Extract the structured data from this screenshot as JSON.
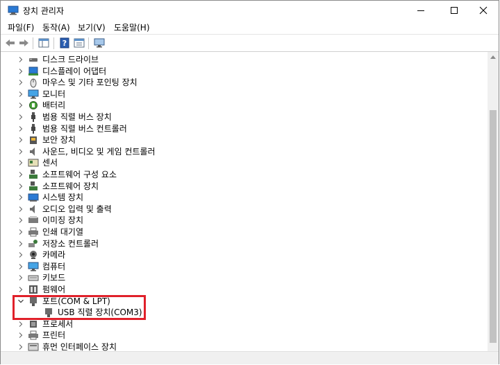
{
  "window": {
    "title": "장치 관리자",
    "controls": [
      "minimize-icon",
      "maximize-icon",
      "close-icon"
    ]
  },
  "menubar": [
    {
      "label": "파일(F)"
    },
    {
      "label": "동작(A)"
    },
    {
      "label": "보기(V)"
    },
    {
      "label": "도움말(H)"
    }
  ],
  "toolbar": {
    "buttons": [
      "back-icon",
      "forward-icon",
      "properties-icon",
      "help-icon",
      "scan-icon",
      "monitor-icon"
    ]
  },
  "tree": {
    "items": [
      {
        "label": "디스크 드라이브",
        "icon": "disk-icon",
        "expanded": false,
        "indent": 0
      },
      {
        "label": "디스플레이 어댑터",
        "icon": "display-adapter-icon",
        "expanded": false,
        "indent": 0
      },
      {
        "label": "마우스 및 기타 포인팅 장치",
        "icon": "mouse-icon",
        "expanded": false,
        "indent": 0
      },
      {
        "label": "모니터",
        "icon": "monitor-icon",
        "expanded": false,
        "indent": 0
      },
      {
        "label": "배터리",
        "icon": "battery-icon",
        "expanded": false,
        "indent": 0
      },
      {
        "label": "범용 직렬 버스 장치",
        "icon": "usb-icon",
        "expanded": false,
        "indent": 0
      },
      {
        "label": "범용 직렬 버스 컨트롤러",
        "icon": "usb-icon",
        "expanded": false,
        "indent": 0
      },
      {
        "label": "보안 장치",
        "icon": "security-icon",
        "expanded": false,
        "indent": 0
      },
      {
        "label": "사운드, 비디오 및 게임 컨트롤러",
        "icon": "speaker-icon",
        "expanded": false,
        "indent": 0
      },
      {
        "label": "센서",
        "icon": "sensor-icon",
        "expanded": false,
        "indent": 0
      },
      {
        "label": "소프트웨어 구성 요소",
        "icon": "software-icon",
        "expanded": false,
        "indent": 0
      },
      {
        "label": "소프트웨어 장치",
        "icon": "software-icon",
        "expanded": false,
        "indent": 0
      },
      {
        "label": "시스템 장치",
        "icon": "system-icon",
        "expanded": false,
        "indent": 0
      },
      {
        "label": "오디오 입력 및 출력",
        "icon": "speaker-icon",
        "expanded": false,
        "indent": 0
      },
      {
        "label": "이미징 장치",
        "icon": "imaging-icon",
        "expanded": false,
        "indent": 0
      },
      {
        "label": "인쇄 대기열",
        "icon": "printer-icon",
        "expanded": false,
        "indent": 0
      },
      {
        "label": "저장소 컨트롤러",
        "icon": "storage-icon",
        "expanded": false,
        "indent": 0
      },
      {
        "label": "카메라",
        "icon": "camera-icon",
        "expanded": false,
        "indent": 0
      },
      {
        "label": "컴퓨터",
        "icon": "computer-icon",
        "expanded": false,
        "indent": 0
      },
      {
        "label": "키보드",
        "icon": "keyboard-icon",
        "expanded": false,
        "indent": 0
      },
      {
        "label": "펌웨어",
        "icon": "firmware-icon",
        "expanded": false,
        "indent": 0
      },
      {
        "label": "포트(COM & LPT)",
        "icon": "port-icon",
        "expanded": true,
        "indent": 0
      },
      {
        "label": "USB 직렬 장치(COM3)",
        "icon": "port-icon",
        "expanded": null,
        "indent": 1
      },
      {
        "label": "프로세서",
        "icon": "processor-icon",
        "expanded": false,
        "indent": 0
      },
      {
        "label": "프린터",
        "icon": "printer-icon",
        "expanded": false,
        "indent": 0
      },
      {
        "label": "휴먼 인터페이스 장치",
        "icon": "hid-icon",
        "expanded": false,
        "indent": 0
      }
    ]
  },
  "colors": {
    "highlight_border": "#e0202a",
    "accent_blue": "#2a7ad4"
  }
}
